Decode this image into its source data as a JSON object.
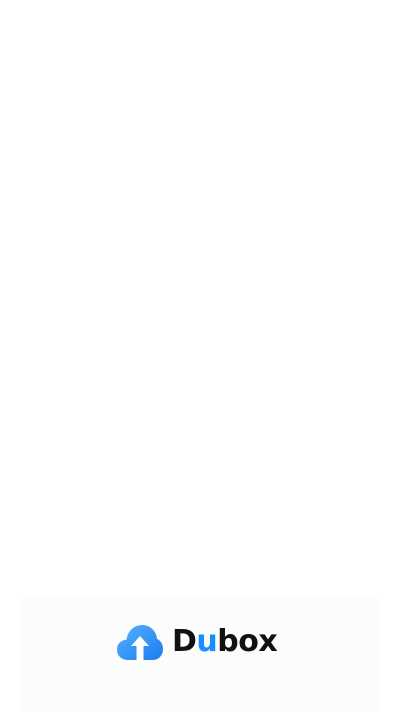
{
  "splash": {
    "brand_name": "Dubox",
    "brand_name_parts": [
      "D",
      "u",
      "box"
    ],
    "logo_icon": "cloud-upload-icon"
  },
  "colors": {
    "background": "#ffffff",
    "bottom_band": "#fcfcfc",
    "accent": "#1a8cff",
    "logo_cloud": "#2e96ff",
    "wordmark_text": "#111111"
  }
}
